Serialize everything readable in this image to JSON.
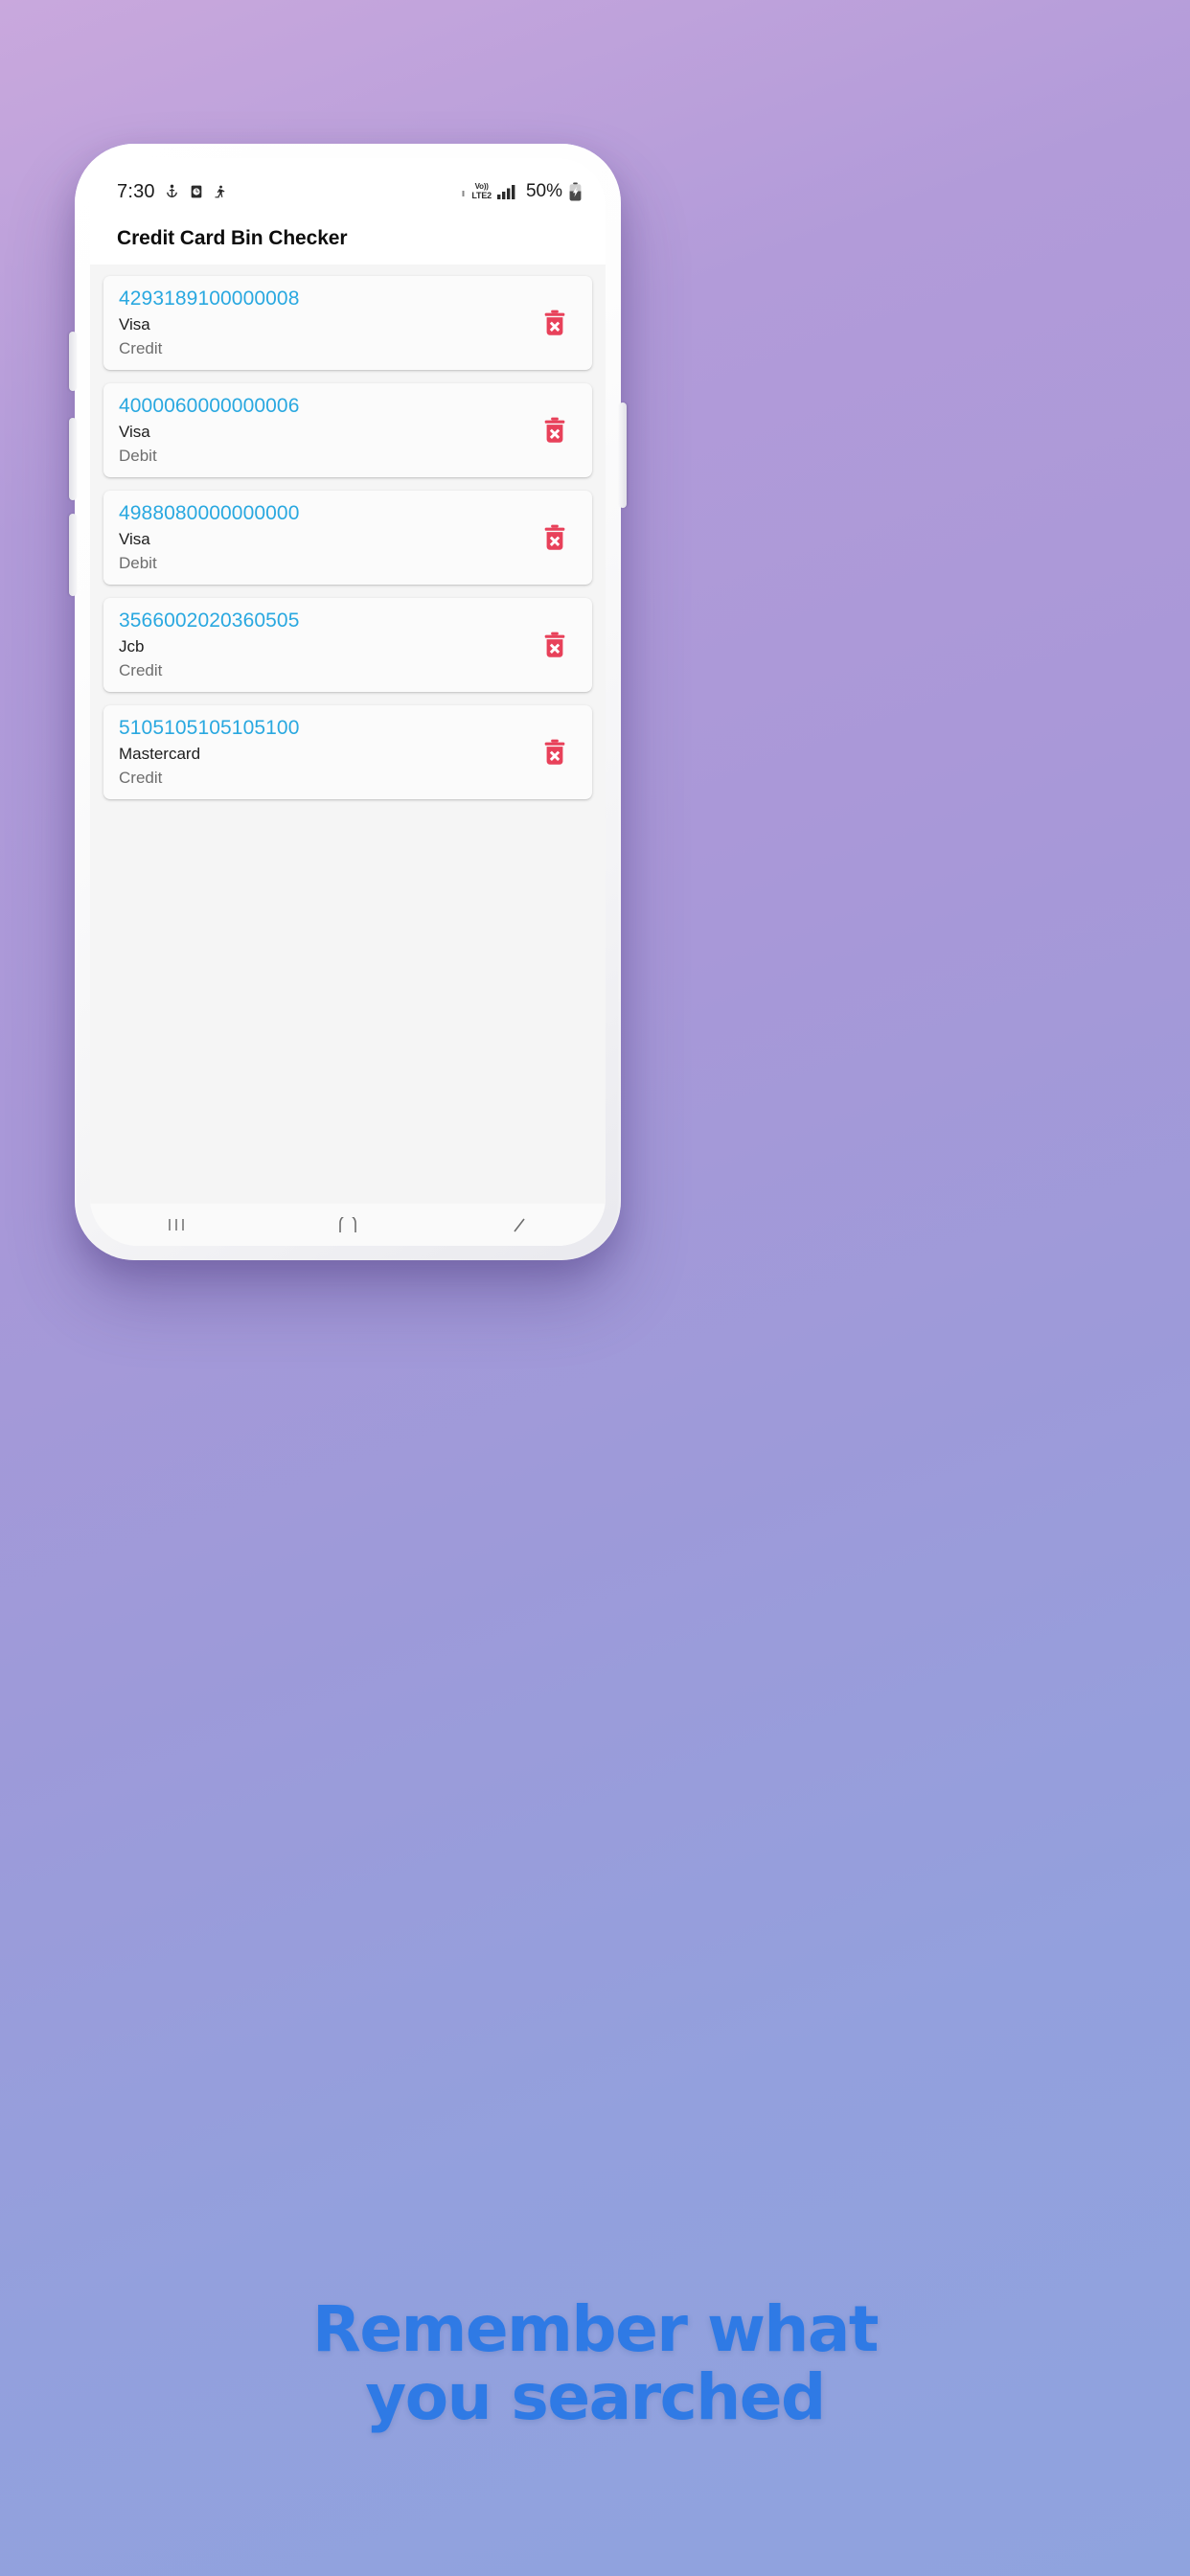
{
  "background": {
    "gradient_from": "#c9a8dd",
    "gradient_to": "#8fa3de"
  },
  "phone": {
    "frame_color": "#ffffff",
    "hardware": {
      "earpiece_speaker": "speaker-grille",
      "front_camera": "front-camera",
      "side_buttons": [
        "bixby",
        "volume-up",
        "volume-down",
        "power"
      ]
    }
  },
  "status_bar": {
    "time": "7:30",
    "left_icons": [
      "anchor-icon",
      "alarm-clock-icon",
      "person-walking-icon"
    ],
    "network_label_top": "Vo))",
    "network_label_bottom": "LTE2",
    "signal_icon": "signal-bars-icon",
    "battery_percent": "50%",
    "battery_icon": "battery-charging-icon"
  },
  "app_bar": {
    "title": "Credit Card Bin Checker"
  },
  "colors": {
    "card_number": "#29a8e0",
    "card_scheme": "#1d1d1d",
    "card_type": "#6e6e6e",
    "delete_icon": "#e8415a",
    "caption": "#2f7ae5",
    "list_background": "#f5f5f5"
  },
  "history": {
    "delete_icon_name": "delete-trash-icon",
    "items": [
      {
        "number": "4293189100000008",
        "scheme": "Visa",
        "type": "Credit"
      },
      {
        "number": "4000060000000006",
        "scheme": "Visa",
        "type": "Debit"
      },
      {
        "number": "4988080000000000",
        "scheme": "Visa",
        "type": "Debit"
      },
      {
        "number": "3566002020360505",
        "scheme": "Jcb",
        "type": "Credit"
      },
      {
        "number": "5105105105105100",
        "scheme": "Mastercard",
        "type": "Credit"
      }
    ]
  },
  "nav_bar": {
    "recents_icon": "recents-icon",
    "home_icon": "home-icon",
    "back_icon": "back-icon"
  },
  "caption": {
    "line1": "Remember what",
    "line2": "you searched"
  }
}
